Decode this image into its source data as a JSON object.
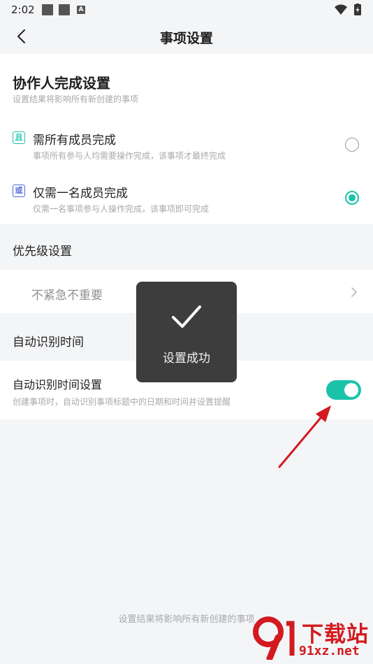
{
  "status_bar": {
    "time": "2:02",
    "notification_badge": "A"
  },
  "nav": {
    "title": "事项设置"
  },
  "collaborator": {
    "title": "协作人完成设置",
    "subtitle": "设置结果将影响所有新创建的事项",
    "options": [
      {
        "icon_char": "且",
        "label": "需所有成员完成",
        "description": "事项所有参与人均需要操作完成，该事项才最终完成",
        "selected": false,
        "icon_color": "#1bc2aa"
      },
      {
        "icon_char": "或",
        "label": "仅需一名成员完成",
        "description": "仅需一名事项参与人操作完成，该事项即可完成",
        "selected": true,
        "icon_color": "#4d6ad6"
      }
    ]
  },
  "priority": {
    "section_label": "优先级设置",
    "value": "不紧急不重要"
  },
  "auto_time": {
    "section_label": "自动识别时间",
    "setting_title": "自动识别时间设置",
    "setting_description": "创建事项时，自动识别事项标题中的日期和时间并设置提醒",
    "enabled": true
  },
  "toast": {
    "message": "设置成功"
  },
  "footer": {
    "note": "设置结果将影响所有新创建的事项"
  },
  "watermark": {
    "brand_cn": "下载站",
    "brand_url": "91xz.net"
  },
  "colors": {
    "accent": "#1bc2aa",
    "annotation_arrow": "#d2191f"
  }
}
